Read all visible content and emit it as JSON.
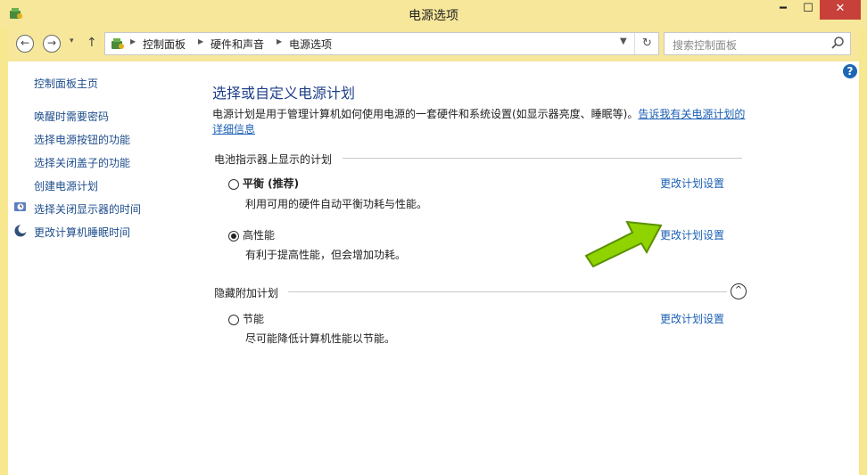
{
  "window": {
    "title": "电源选项",
    "min_symbol": "━",
    "max_symbol": "☐",
    "close_symbol": "✕"
  },
  "nav": {
    "back_symbol": "←",
    "forward_symbol": "→",
    "recent_symbol": "▾",
    "up_symbol": "↑",
    "breadcrumb": [
      "控制面板",
      "硬件和声音",
      "电源选项"
    ],
    "search_placeholder": "搜索控制面板"
  },
  "sidebar": {
    "home": "控制面板主页",
    "links": [
      "唤醒时需要密码",
      "选择电源按钮的功能",
      "选择关闭盖子的功能",
      "创建电源计划",
      "选择关闭显示器的时间",
      "更改计算机睡眠时间"
    ]
  },
  "main": {
    "title": "选择或自定义电源计划",
    "desc_text": "电源计划是用于管理计算机如何使用电源的一套硬件和系统设置(如显示器亮度、睡眠等)。",
    "desc_link": "告诉我有关电源计划的详细信息",
    "group1_title": "电池指示器上显示的计划",
    "group2_title": "隐藏附加计划",
    "plans": [
      {
        "name": "平衡 (推荐)",
        "desc": "利用可用的硬件自动平衡功耗与性能。",
        "link": "更改计划设置",
        "selected": false
      },
      {
        "name": "高性能",
        "desc": "有利于提高性能，但会增加功耗。",
        "link": "更改计划设置",
        "selected": true
      },
      {
        "name": "节能",
        "desc": "尽可能降低计算机性能以节能。",
        "link": "更改计划设置",
        "selected": false
      }
    ],
    "help_symbol": "?",
    "collapse_symbol": "^"
  },
  "colors": {
    "link": "#1a5fb4",
    "title": "#1e3f8a",
    "frame": "#f7e79a",
    "close": "#c7403a",
    "arrow": "#8fd300"
  }
}
